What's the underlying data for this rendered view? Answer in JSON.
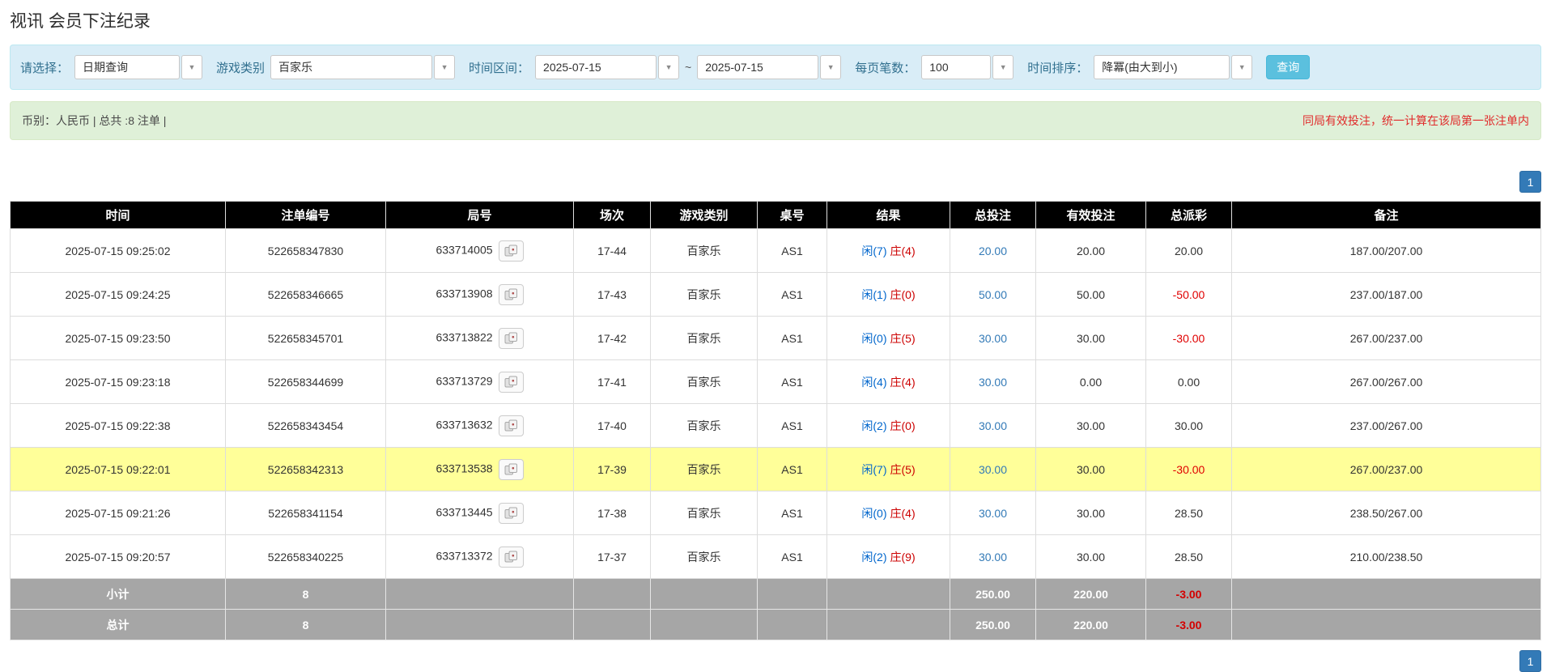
{
  "page": {
    "title": "视讯 会员下注纪录"
  },
  "filters": {
    "select_label": "请选择：",
    "select_value": "日期查询",
    "game_label": "游戏类别",
    "game_value": "百家乐",
    "range_label": "时间区间：",
    "date_from": "2025-07-15",
    "range_separator": "~",
    "date_to": "2025-07-15",
    "page_size_label": "每页笔数：",
    "page_size_value": "100",
    "sort_label": "时间排序：",
    "sort_value": "降冪(由大到小)",
    "search_button_label": "查询"
  },
  "summary_bar": {
    "left_text": "币别：人民币 | 总共 :8 注单 |",
    "right_notice": "同局有效投注，统一计算在该局第一张注单内"
  },
  "pagination": {
    "top_page": "1",
    "bottom_page": "1"
  },
  "colors": {
    "accent_blue": "#337ab7",
    "button_cyan": "#5bc0de",
    "player_blue": "#0066cc",
    "banker_red": "#cc0000",
    "negative_red": "#e00000",
    "highlight_yellow": "#ffff99",
    "header_black": "#000000",
    "summary_gray": "#a6a6a6"
  },
  "table": {
    "headers": [
      "时间",
      "注单编号",
      "局号",
      "场次",
      "游戏类别",
      "桌号",
      "结果",
      "总投注",
      "有效投注",
      "总派彩",
      "备注"
    ],
    "rows": [
      {
        "time": "2025-07-15 09:25:02",
        "bet_id": "522658347830",
        "round_id": "633714005",
        "session": "17-44",
        "game": "百家乐",
        "table_no": "AS1",
        "player": "闲(7)",
        "banker": "庄(4)",
        "total_bet": "20.00",
        "valid_bet": "20.00",
        "payout": "20.00",
        "note": "187.00/207.00",
        "highlighted": false
      },
      {
        "time": "2025-07-15 09:24:25",
        "bet_id": "522658346665",
        "round_id": "633713908",
        "session": "17-43",
        "game": "百家乐",
        "table_no": "AS1",
        "player": "闲(1)",
        "banker": "庄(0)",
        "total_bet": "50.00",
        "valid_bet": "50.00",
        "payout": "-50.00",
        "note": "237.00/187.00",
        "highlighted": false
      },
      {
        "time": "2025-07-15 09:23:50",
        "bet_id": "522658345701",
        "round_id": "633713822",
        "session": "17-42",
        "game": "百家乐",
        "table_no": "AS1",
        "player": "闲(0)",
        "banker": "庄(5)",
        "total_bet": "30.00",
        "valid_bet": "30.00",
        "payout": "-30.00",
        "note": "267.00/237.00",
        "highlighted": false
      },
      {
        "time": "2025-07-15 09:23:18",
        "bet_id": "522658344699",
        "round_id": "633713729",
        "session": "17-41",
        "game": "百家乐",
        "table_no": "AS1",
        "player": "闲(4)",
        "banker": "庄(4)",
        "total_bet": "30.00",
        "valid_bet": "0.00",
        "payout": "0.00",
        "note": "267.00/267.00",
        "highlighted": false
      },
      {
        "time": "2025-07-15 09:22:38",
        "bet_id": "522658343454",
        "round_id": "633713632",
        "session": "17-40",
        "game": "百家乐",
        "table_no": "AS1",
        "player": "闲(2)",
        "banker": "庄(0)",
        "total_bet": "30.00",
        "valid_bet": "30.00",
        "payout": "30.00",
        "note": "237.00/267.00",
        "highlighted": false
      },
      {
        "time": "2025-07-15 09:22:01",
        "bet_id": "522658342313",
        "round_id": "633713538",
        "session": "17-39",
        "game": "百家乐",
        "table_no": "AS1",
        "player": "闲(7)",
        "banker": "庄(5)",
        "total_bet": "30.00",
        "valid_bet": "30.00",
        "payout": "-30.00",
        "note": "267.00/237.00",
        "highlighted": true
      },
      {
        "time": "2025-07-15 09:21:26",
        "bet_id": "522658341154",
        "round_id": "633713445",
        "session": "17-38",
        "game": "百家乐",
        "table_no": "AS1",
        "player": "闲(0)",
        "banker": "庄(4)",
        "total_bet": "30.00",
        "valid_bet": "30.00",
        "payout": "28.50",
        "note": "238.50/267.00",
        "highlighted": false
      },
      {
        "time": "2025-07-15 09:20:57",
        "bet_id": "522658340225",
        "round_id": "633713372",
        "session": "17-37",
        "game": "百家乐",
        "table_no": "AS1",
        "player": "闲(2)",
        "banker": "庄(9)",
        "total_bet": "30.00",
        "valid_bet": "30.00",
        "payout": "28.50",
        "note": "210.00/238.50",
        "highlighted": false
      }
    ],
    "subtotal_row": {
      "label": "小计",
      "count": "8",
      "total_bet": "250.00",
      "valid_bet": "220.00",
      "payout": "-3.00"
    },
    "total_row": {
      "label": "总计",
      "count": "8",
      "total_bet": "250.00",
      "valid_bet": "220.00",
      "payout": "-3.00"
    }
  }
}
